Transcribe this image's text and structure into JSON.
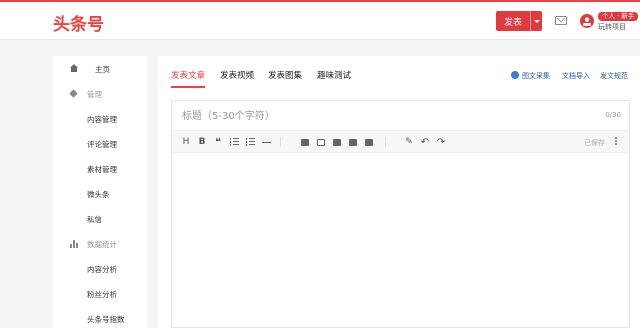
{
  "header": {
    "logo": "头条号",
    "publish_button": "发表",
    "badge": "个人 · 新手",
    "username": "玩转项目"
  },
  "sidebar": {
    "items": [
      {
        "label": "主页",
        "kind": "top",
        "icon": "home-icon"
      },
      {
        "label": "管理",
        "kind": "group",
        "icon": "cube-icon"
      },
      {
        "label": "内容管理",
        "kind": "sub"
      },
      {
        "label": "评论管理",
        "kind": "sub"
      },
      {
        "label": "素材管理",
        "kind": "sub"
      },
      {
        "label": "微头条",
        "kind": "sub"
      },
      {
        "label": "私信",
        "kind": "sub"
      },
      {
        "label": "数据统计",
        "kind": "group",
        "icon": "bar-chart-icon"
      },
      {
        "label": "内容分析",
        "kind": "sub"
      },
      {
        "label": "粉丝分析",
        "kind": "sub"
      },
      {
        "label": "头条号指数",
        "kind": "sub"
      }
    ]
  },
  "main": {
    "tabs": [
      {
        "label": "发表文章",
        "active": true
      },
      {
        "label": "发表视频",
        "active": false
      },
      {
        "label": "发表图集",
        "active": false
      },
      {
        "label": "趣味测试",
        "active": false
      }
    ],
    "tools": {
      "image_collect": "图文采集",
      "doc_import": "文档导入",
      "guidelines": "发文规范"
    },
    "editor": {
      "title_placeholder": "标题（5-30个字符）",
      "counter": "0/30",
      "saved_status": "已保存"
    }
  },
  "colors": {
    "brand_red": "#f04142",
    "link_blue": "#2a5aa8"
  }
}
